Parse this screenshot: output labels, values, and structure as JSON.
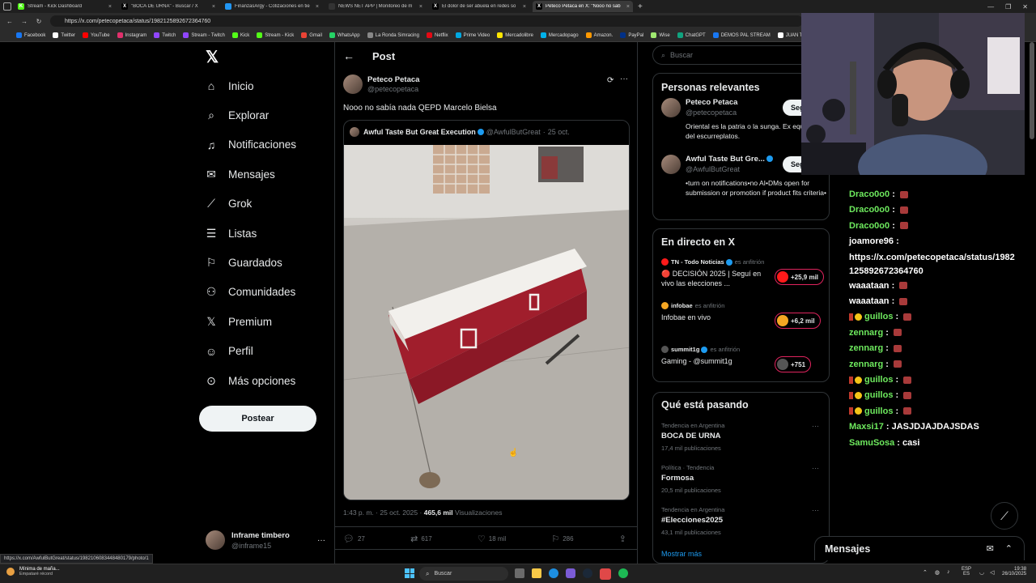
{
  "browser": {
    "tabs": [
      {
        "title": "Stream - Kick Dashboard",
        "icon_color": "#53fc18",
        "icon": "K"
      },
      {
        "title": "\"BOCA DE URNA\" - Buscar / X",
        "icon_color": "#000000",
        "icon": "X"
      },
      {
        "title": "FinanzasArgy - Cotizaciones en tie",
        "icon_color": "#2196f3",
        "icon": ""
      },
      {
        "title": "NEWS NET APP | Monitoreo de m",
        "icon_color": "#333333",
        "icon": ""
      },
      {
        "title": "El dolor de ser abuela en redes so",
        "icon_color": "#000000",
        "icon": "X"
      },
      {
        "title": "Peteco Petaca en X: \"Nooo no sab",
        "icon_color": "#000000",
        "icon": "X"
      }
    ],
    "url": "https://x.com/petecopetaca/status/1982125892672364760",
    "bookmarks": [
      {
        "label": "Facebook",
        "color": "#1877f2"
      },
      {
        "label": "Twitter",
        "color": "#ffffff"
      },
      {
        "label": "YouTube",
        "color": "#ff0000"
      },
      {
        "label": "Instagram",
        "color": "#e1306c"
      },
      {
        "label": "Twitch",
        "color": "#9146ff"
      },
      {
        "label": "Stream - Twitch",
        "color": "#9146ff"
      },
      {
        "label": "Kick",
        "color": "#53fc18"
      },
      {
        "label": "Stream - Kick",
        "color": "#53fc18"
      },
      {
        "label": "Gmail",
        "color": "#ea4335"
      },
      {
        "label": "WhatsApp",
        "color": "#25d366"
      },
      {
        "label": "La Ronda Simracing",
        "color": "#888888"
      },
      {
        "label": "Netflix",
        "color": "#e50914"
      },
      {
        "label": "Prime Video",
        "color": "#00a8e1"
      },
      {
        "label": "Mercadolibre",
        "color": "#ffe600"
      },
      {
        "label": "Mercadopago",
        "color": "#00b1ea"
      },
      {
        "label": "Amazon.",
        "color": "#ff9900"
      },
      {
        "label": "PayPal",
        "color": "#003087"
      },
      {
        "label": "Wise",
        "color": "#9fe870"
      },
      {
        "label": "ChatGPT",
        "color": "#10a37f"
      },
      {
        "label": "DEMOS PAL STREAM",
        "color": "#1877f2"
      },
      {
        "label": "JUAN TUR",
        "color": "#ffffff"
      }
    ]
  },
  "leftnav": {
    "items": [
      {
        "label": "Inicio",
        "icon": "home-icon"
      },
      {
        "label": "Explorar",
        "icon": "search-icon"
      },
      {
        "label": "Notificaciones",
        "icon": "bell-icon"
      },
      {
        "label": "Mensajes",
        "icon": "mail-icon"
      },
      {
        "label": "Grok",
        "icon": "grok-icon"
      },
      {
        "label": "Listas",
        "icon": "list-icon"
      },
      {
        "label": "Guardados",
        "icon": "bookmark-icon"
      },
      {
        "label": "Comunidades",
        "icon": "people-icon"
      },
      {
        "label": "Premium",
        "icon": "x-icon"
      },
      {
        "label": "Perfil",
        "icon": "person-icon"
      },
      {
        "label": "Más opciones",
        "icon": "more-circle-icon"
      }
    ],
    "post_button": "Postear",
    "account": {
      "name": "Inframe timbero",
      "handle": "@inframe15"
    }
  },
  "post": {
    "header": "Post",
    "author": {
      "name": "Peteco Petaca",
      "handle": "@petecopetaca"
    },
    "text": "Nooo no sabía nada QEPD Marcelo Bielsa",
    "quote": {
      "name": "Awful Taste But Great Execution",
      "handle": "@AwfulButGreat",
      "date": "25 oct."
    },
    "time": "1:43 p. m. · 25 oct. 2025 ·",
    "views": "465,6 mil",
    "views_label": "Visualizaciones",
    "replies": "27",
    "reposts": "617",
    "likes": "18 mil",
    "bookmarks": "286"
  },
  "right": {
    "search_placeholder": "Buscar",
    "relevant": {
      "title": "Personas relevantes",
      "follow_label": "Seg",
      "people": [
        {
          "name": "Peteco Petaca",
          "handle": "@petecopetaca",
          "bio": "Oriental es la patria o la sunga. Ex equilibrista del escurreplatos."
        },
        {
          "name": "Awful Taste But Gre...",
          "handle": "@AwfulButGreat",
          "bio": "•turn on notifications•no AI•DMs open for submission or promotion if product fits criteria•"
        }
      ]
    },
    "live": {
      "title": "En directo en X",
      "host_label": "es anfitrión",
      "items": [
        {
          "host": "TN - Todo Noticias",
          "title": "🔴 DECISIÓN 2025 | Seguí en vivo las elecciones ...",
          "count": "+25,9 mil"
        },
        {
          "host": "infobae",
          "title": "Infobae en vivo",
          "count": "+6,2 mil"
        },
        {
          "host": "summit1g",
          "title": "Gaming - @summit1g",
          "count": "+751"
        }
      ]
    },
    "trending": {
      "title": "Qué está pasando",
      "items": [
        {
          "context": "Tendencia en Argentina",
          "name": "BOCA DE URNA",
          "posts": "17,4 mil publicaciones"
        },
        {
          "context": "Política · Tendencia",
          "name": "Formosa",
          "posts": "20,5 mil publicaciones"
        },
        {
          "context": "Tendencia en Argentina",
          "name": "#Elecciones2025",
          "posts": "43,1 mil publicaciones"
        }
      ],
      "show_more": "Mostrar más"
    }
  },
  "chat": {
    "messages": [
      {
        "user": "Draco0o0",
        "text": "",
        "emote": true,
        "badges": false
      },
      {
        "user": "Draco0o0",
        "text": "",
        "emote": true,
        "badges": false
      },
      {
        "user": "Draco0o0",
        "text": "",
        "emote": true,
        "badges": false
      },
      {
        "user": "joamore96",
        "text": "",
        "emote": false,
        "badges": false,
        "white": true
      },
      {
        "user": "",
        "text": "https://x.com/petecopetaca/status/1982",
        "emote": false,
        "badges": false,
        "plain": true
      },
      {
        "user": "",
        "text": "125892672364760",
        "emote": false,
        "badges": false,
        "plain": true
      },
      {
        "user": "waaataan",
        "text": "",
        "emote": true,
        "badges": false,
        "white": true
      },
      {
        "user": "waaataan",
        "text": "",
        "emote": true,
        "badges": false,
        "white": true
      },
      {
        "user": "guillos",
        "text": "",
        "emote": true,
        "badges": true
      },
      {
        "user": "zennarg",
        "text": "",
        "emote": true,
        "badges": false
      },
      {
        "user": "zennarg",
        "text": "",
        "emote": true,
        "badges": false
      },
      {
        "user": "zennarg",
        "text": "",
        "emote": true,
        "badges": false
      },
      {
        "user": "guillos",
        "text": "",
        "emote": true,
        "badges": true
      },
      {
        "user": "guillos",
        "text": "",
        "emote": true,
        "badges": true
      },
      {
        "user": "guillos",
        "text": "",
        "emote": true,
        "badges": true
      },
      {
        "user": "Maxsi17",
        "text": "JASJDJAJDAJSDAS",
        "emote": false,
        "badges": false
      },
      {
        "user": "SamuSosa",
        "text": "casi",
        "emote": false,
        "badges": false
      }
    ]
  },
  "dm": {
    "title": "Mensajes"
  },
  "statusbar": {
    "url": "https://x.com/AwfulButGreat/status/1982106083448480179/photo/1"
  },
  "taskbar": {
    "notif_title": "Mínima de maña...",
    "notif_sub": "Empataré récord",
    "search": "Buscar",
    "lang": "ESP",
    "lang2": "ES",
    "time": "19:38",
    "date": "26/10/2025"
  }
}
